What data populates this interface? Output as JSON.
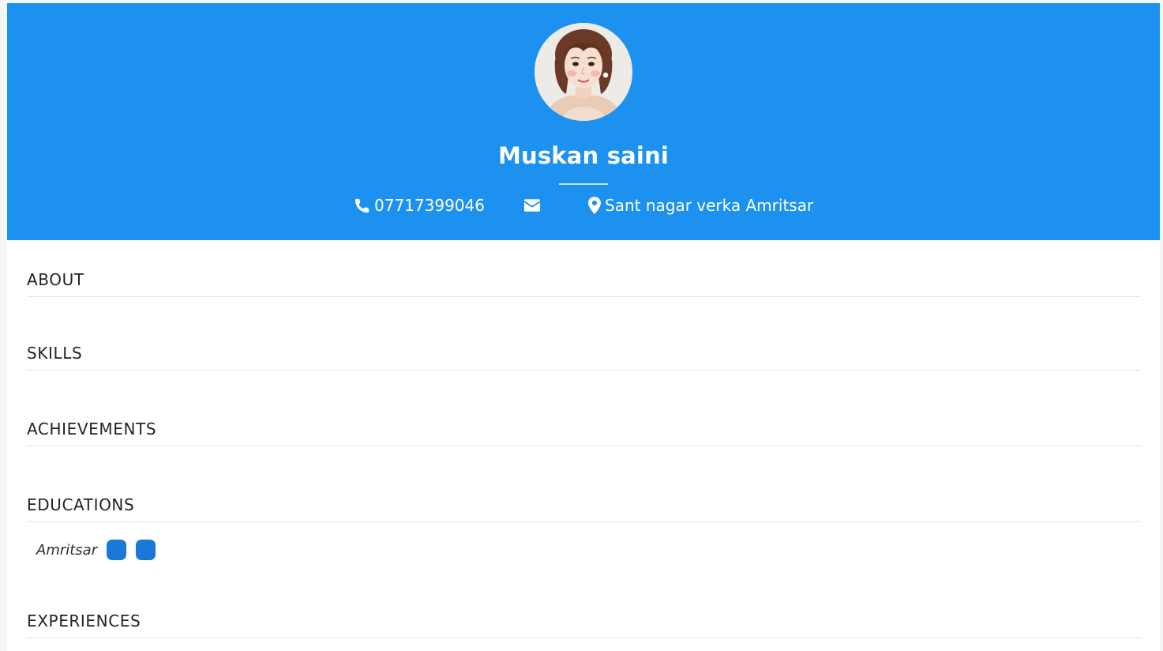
{
  "profile": {
    "name": "Muskan saini",
    "phone": "07717399046",
    "email": "",
    "address": "Sant nagar verka Amritsar"
  },
  "sections": {
    "about": {
      "title": "ABOUT"
    },
    "skills": {
      "title": "SKILLS"
    },
    "achievements": {
      "title": "ACHIEVEMENTS"
    },
    "educations": {
      "title": "EDUCATIONS",
      "items": [
        {
          "place": "Amritsar",
          "badges": [
            "",
            ""
          ]
        }
      ]
    },
    "experiences": {
      "title": "EXPERIENCES"
    }
  },
  "icons": {
    "phone": "phone-icon",
    "email": "envelope-icon",
    "address": "map-marker-icon"
  },
  "colors": {
    "header_bg": "#1c91f0",
    "badge": "#1a79d6",
    "page_bg": "#ffffff",
    "rule": "#e3e5e8"
  }
}
